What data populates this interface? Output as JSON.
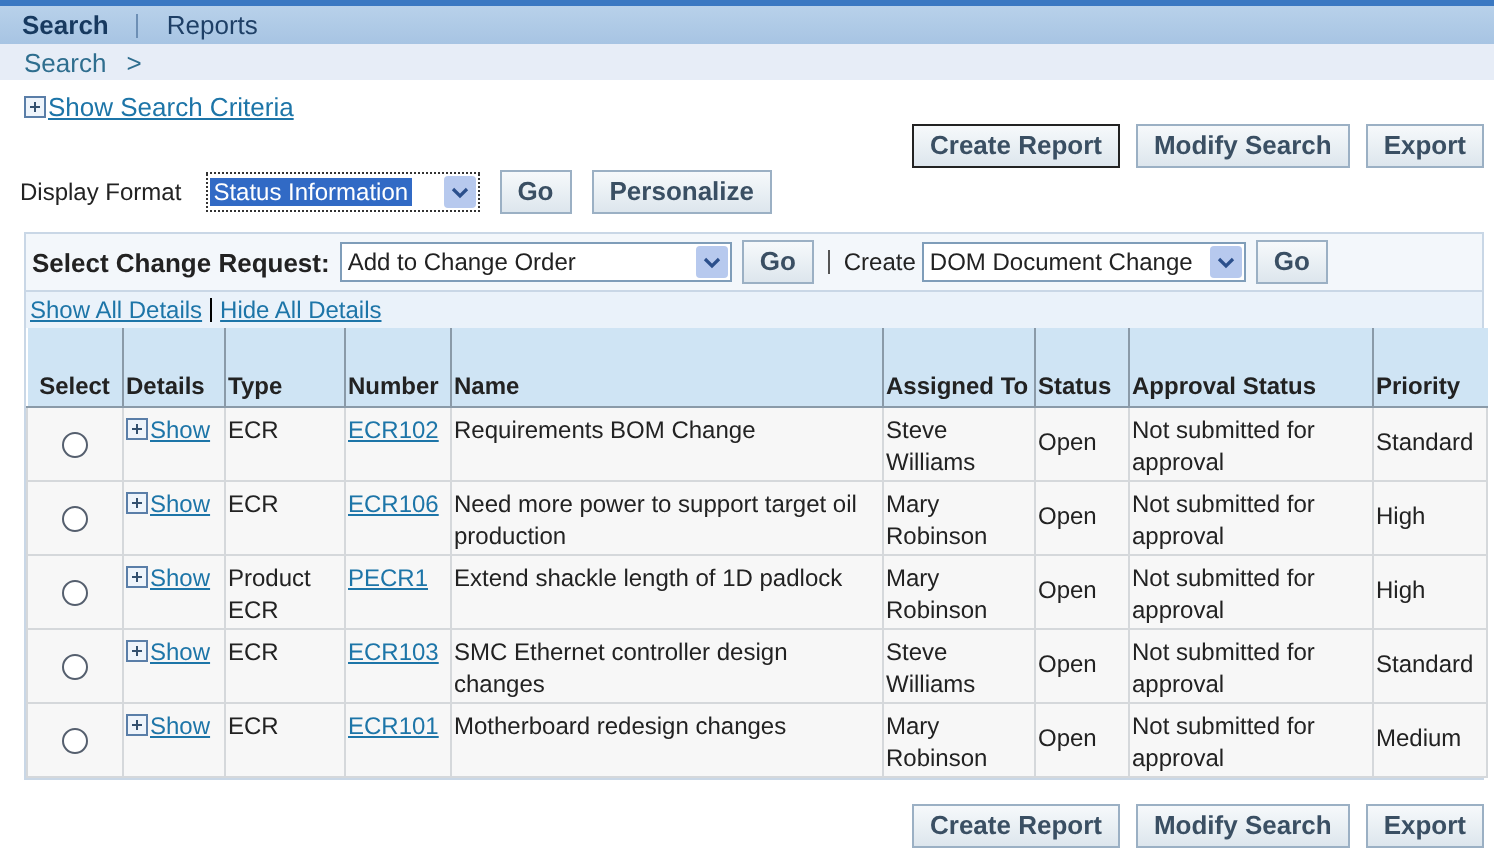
{
  "tabs": [
    {
      "label": "Search",
      "selected": true
    },
    {
      "label": "Reports",
      "selected": false
    }
  ],
  "breadcrumb": {
    "link": "Search",
    "separator": ">"
  },
  "search_criteria_link": "Show Search Criteria",
  "top_buttons": [
    "Create Report",
    "Modify Search",
    "Export"
  ],
  "display_format": {
    "label": "Display Format",
    "value": "Status Information",
    "go": "Go",
    "personalize": "Personalize"
  },
  "change_request": {
    "label": "Select Change Request:",
    "value": "Add to Change Order",
    "go": "Go",
    "create_label": "Create",
    "create_value": "DOM Document Change",
    "create_go": "Go"
  },
  "detail_links": [
    "Show All Details",
    "Hide All Details"
  ],
  "table": {
    "columns": [
      "Select",
      "Details",
      "Type",
      "Number",
      "Name",
      "Assigned To",
      "Status",
      "Approval Status",
      "Priority"
    ],
    "rows": [
      {
        "selected": false,
        "details": "Show",
        "type": "ECR",
        "number": "ECR102",
        "name": "Requirements BOM Change",
        "assigned_to": "Steve Williams",
        "status": "Open",
        "approval_status": "Not submitted for approval",
        "priority": "Standard"
      },
      {
        "selected": false,
        "details": "Show",
        "type": "ECR",
        "number": "ECR106",
        "name": "Need more power to support target oil production",
        "assigned_to": "Mary Robinson",
        "status": "Open",
        "approval_status": "Not submitted for approval",
        "priority": "High"
      },
      {
        "selected": false,
        "details": "Show",
        "type": "Product ECR",
        "number": "PECR1",
        "name": "Extend shackle length of 1D padlock",
        "assigned_to": "Mary Robinson",
        "status": "Open",
        "approval_status": "Not submitted for approval",
        "priority": "High"
      },
      {
        "selected": false,
        "details": "Show",
        "type": "ECR",
        "number": "ECR103",
        "name": "SMC Ethernet controller design changes",
        "assigned_to": "Steve Williams",
        "status": "Open",
        "approval_status": "Not submitted for approval",
        "priority": "Standard"
      },
      {
        "selected": false,
        "details": "Show",
        "type": "ECR",
        "number": "ECR101",
        "name": "Motherboard redesign changes",
        "assigned_to": "Mary Robinson",
        "status": "Open",
        "approval_status": "Not submitted for approval",
        "priority": "Medium"
      }
    ]
  },
  "bottom_buttons": [
    "Create Report",
    "Modify Search",
    "Export"
  ]
}
